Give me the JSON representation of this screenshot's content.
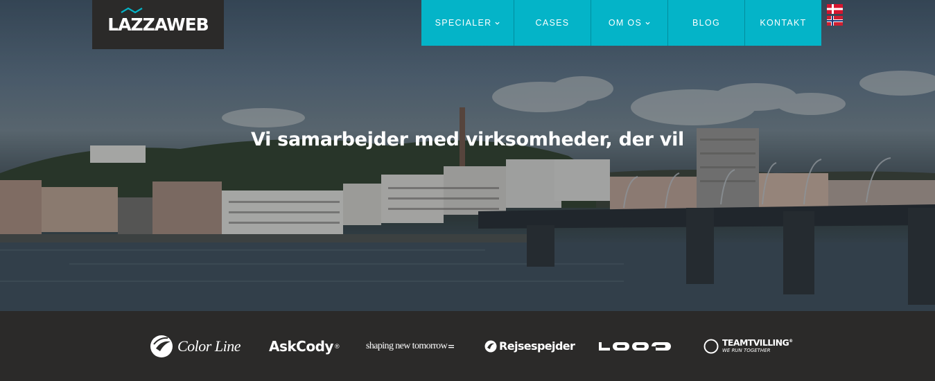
{
  "header": {
    "logo_text": "LAZZAWEB",
    "nav": [
      {
        "label": "SPECIALER",
        "has_dropdown": true
      },
      {
        "label": "CASES",
        "has_dropdown": false
      },
      {
        "label": "OM OS",
        "has_dropdown": true
      },
      {
        "label": "BLOG",
        "has_dropdown": false
      },
      {
        "label": "KONTAKT",
        "has_dropdown": false
      }
    ],
    "languages": [
      "danish-flag-icon",
      "norwegian-flag-icon"
    ]
  },
  "hero": {
    "headline": "Vi samarbejder med virksomheder, der vil"
  },
  "clients": {
    "colorline": "Color Line",
    "askcody": "AskCody",
    "askcody_mark": "®",
    "shaping": "shaping new tomorrow",
    "rejsespejder": "Rejsespejder",
    "loop": "LOOP",
    "teamtvilling": "TEAMTVILLING",
    "teamtvilling_mark": "®",
    "teamtvilling_tagline": "WE RUN TOGETHER"
  },
  "colors": {
    "nav_bg": "#04b4c8",
    "logo_bg": "#2b2a29",
    "strip_bg": "#2b2a29"
  }
}
